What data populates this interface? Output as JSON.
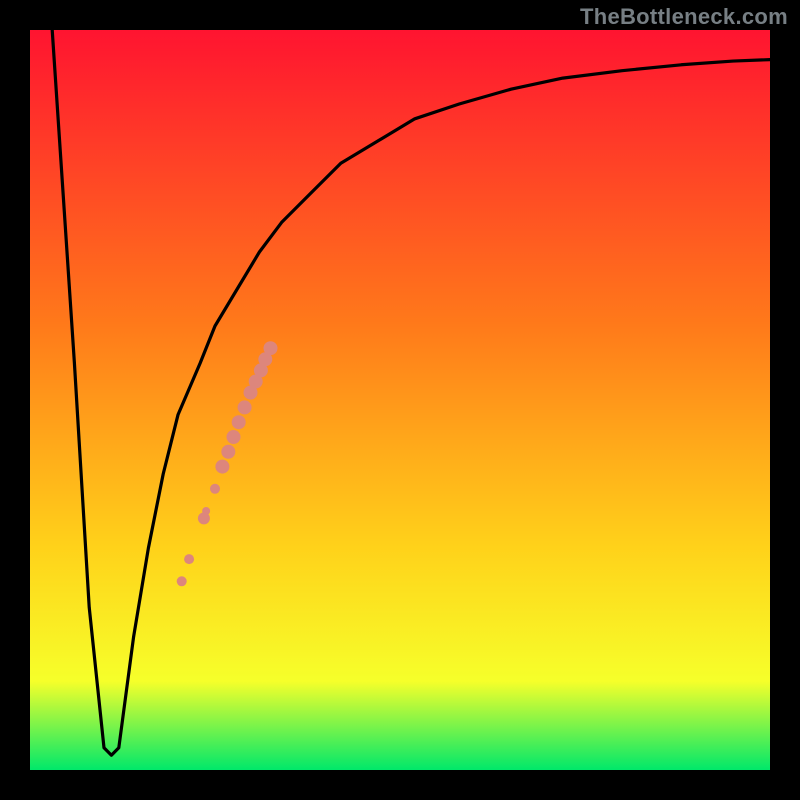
{
  "watermark": "TheBottleneck.com",
  "colors": {
    "gradient_top": "#ff1430",
    "gradient_mid1": "#ff7a1a",
    "gradient_mid2": "#ffd21a",
    "gradient_mid3": "#f6ff2a",
    "gradient_bottom": "#00e86a",
    "frame": "#000000",
    "curve": "#000000",
    "dots": "#dd867c"
  },
  "chart_data": {
    "type": "line",
    "title": "",
    "xlabel": "",
    "ylabel": "",
    "xlim": [
      0,
      100
    ],
    "ylim": [
      0,
      100
    ],
    "legend": false,
    "grid": false,
    "series": [
      {
        "name": "bottleneck-curve",
        "x": [
          3,
          6,
          8,
          10,
          11,
          12,
          14,
          16,
          18,
          20,
          23,
          25,
          28,
          31,
          34,
          38,
          42,
          47,
          52,
          58,
          65,
          72,
          80,
          88,
          95,
          100
        ],
        "y": [
          100,
          55,
          22,
          3,
          2,
          3,
          18,
          30,
          40,
          48,
          55,
          60,
          65,
          70,
          74,
          78,
          82,
          85,
          88,
          90,
          92,
          93.5,
          94.5,
          95.3,
          95.8,
          96
        ]
      }
    ],
    "dots": {
      "name": "highlight-dots",
      "x": [
        20.5,
        21.5,
        23.5,
        23.8,
        25,
        26,
        26.8,
        27.5,
        28.2,
        29,
        29.8,
        30.5,
        31.2,
        31.8,
        32.5
      ],
      "y": [
        25.5,
        28.5,
        34,
        35,
        38,
        41,
        43,
        45,
        47,
        49,
        51,
        52.5,
        54,
        55.5,
        57
      ],
      "r": [
        5,
        5,
        6,
        4,
        5,
        7,
        7,
        7,
        7,
        7,
        7,
        7,
        7,
        7,
        7
      ]
    }
  }
}
